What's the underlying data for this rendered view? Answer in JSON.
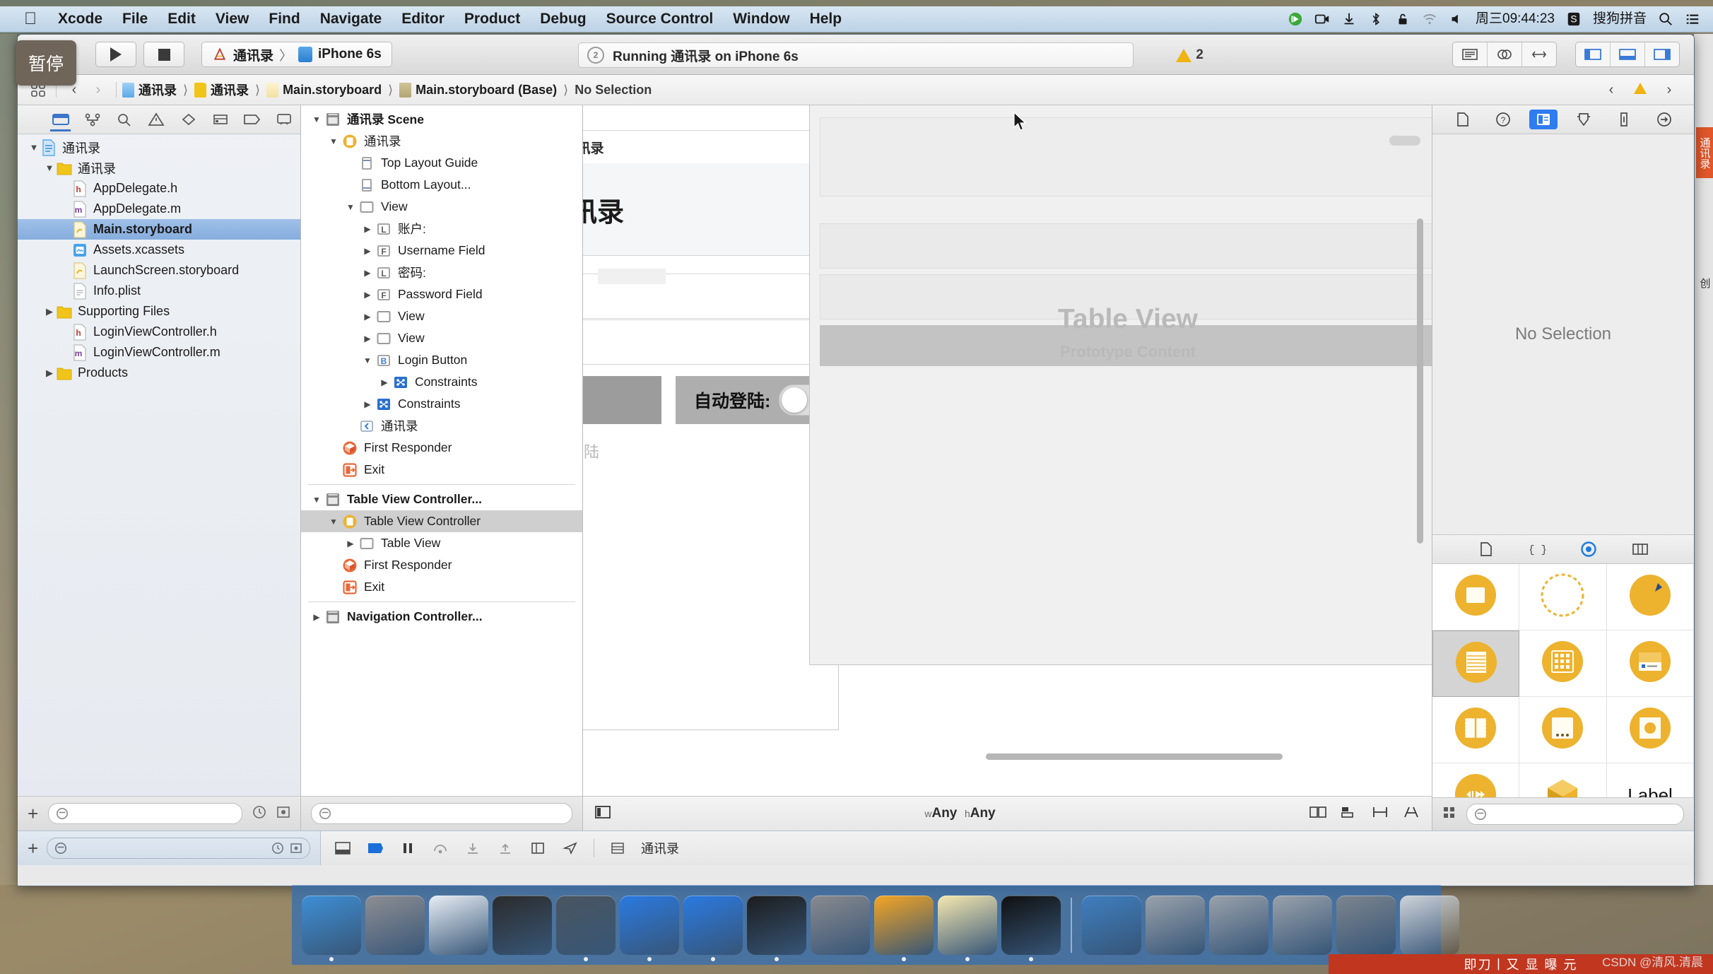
{
  "menubar": {
    "apple": "apple-logo",
    "items": [
      "Xcode",
      "File",
      "Edit",
      "View",
      "Find",
      "Navigate",
      "Editor",
      "Product",
      "Debug",
      "Source Control",
      "Window",
      "Help"
    ],
    "status_icons": [
      "sync-icon",
      "screen-record-icon",
      "airdrop-icon",
      "bluetooth-icon",
      "lock-icon",
      "wifi-icon",
      "volume-icon"
    ],
    "clock": "周三09:44:23",
    "input_method_badge": "S",
    "input_method": "搜狗拼音",
    "search_icon": "search-icon",
    "notification_icon": "notification-center-icon"
  },
  "tooltip": {
    "text": "暂停"
  },
  "toolbar": {
    "run_button": "run-icon",
    "stop_button": "stop-icon",
    "scheme_name": "通讯录",
    "scheme_separator": "〉",
    "destination": "iPhone 6s",
    "status": {
      "icon": "activity-icon",
      "text": "Running 通讯录 on iPhone 6s"
    },
    "warning_count": "2",
    "editor_segments": [
      "standard-editor-icon",
      "assistant-editor-icon",
      "version-editor-icon"
    ],
    "view_segments": [
      "navigator-toggle-icon",
      "debug-area-toggle-icon",
      "utilities-toggle-icon"
    ]
  },
  "jumpbar": {
    "related_icon": "related-items-icon",
    "back_icon": "chevron-left-icon",
    "forward_icon": "chevron-right-icon",
    "crumbs": [
      {
        "icon": "project-icon",
        "label": "通讯录"
      },
      {
        "icon": "folder-icon",
        "label": "通讯录"
      },
      {
        "icon": "storyboard-icon",
        "label": "Main.storyboard"
      },
      {
        "icon": "storyboard-base-icon",
        "label": "Main.storyboard (Base)"
      },
      {
        "icon": "",
        "label": "No Selection"
      }
    ],
    "right_icons": [
      "chevron-left-small-icon",
      "warning-icon",
      "chevron-right-small-icon"
    ]
  },
  "navigator": {
    "tabs": [
      "folder-navigator-icon",
      "source-control-icon",
      "search-navigator-icon",
      "issue-navigator-icon",
      "test-navigator-icon",
      "debug-navigator-icon",
      "breakpoint-navigator-icon",
      "report-navigator-icon"
    ],
    "selected_tab_index": 0,
    "items": [
      {
        "label": "通讯录",
        "indent": 0,
        "twisty": "down",
        "icon": "project-icon",
        "selected": false
      },
      {
        "label": "通讯录",
        "indent": 1,
        "twisty": "down",
        "icon": "folder-icon",
        "selected": false
      },
      {
        "label": "AppDelegate.h",
        "indent": 2,
        "twisty": "",
        "icon": "h-file-icon",
        "selected": false
      },
      {
        "label": "AppDelegate.m",
        "indent": 2,
        "twisty": "",
        "icon": "m-file-icon",
        "selected": false
      },
      {
        "label": "Main.storyboard",
        "indent": 2,
        "twisty": "",
        "icon": "storyboard-icon",
        "selected": true
      },
      {
        "label": "Assets.xcassets",
        "indent": 2,
        "twisty": "",
        "icon": "assets-icon",
        "selected": false
      },
      {
        "label": "LaunchScreen.storyboard",
        "indent": 2,
        "twisty": "",
        "icon": "storyboard-icon",
        "selected": false
      },
      {
        "label": "Info.plist",
        "indent": 2,
        "twisty": "",
        "icon": "plist-icon",
        "selected": false
      },
      {
        "label": "Supporting Files",
        "indent": 1,
        "twisty": "right",
        "icon": "folder-icon",
        "selected": false
      },
      {
        "label": "LoginViewController.h",
        "indent": 2,
        "twisty": "",
        "icon": "h-file-icon",
        "selected": false
      },
      {
        "label": "LoginViewController.m",
        "indent": 2,
        "twisty": "",
        "icon": "m-file-icon",
        "selected": false
      },
      {
        "label": "Products",
        "indent": 1,
        "twisty": "right",
        "icon": "folder-icon",
        "selected": false
      }
    ],
    "add_button": "plus-icon",
    "filter_placeholder": ""
  },
  "outline": {
    "items": [
      {
        "label": "通讯录 Scene",
        "indent": 0,
        "twisty": "down",
        "icon": "scene-icon",
        "bold": true,
        "selected": false
      },
      {
        "label": "通讯录",
        "indent": 1,
        "twisty": "down",
        "icon": "viewcontroller-icon",
        "bold": false,
        "selected": false
      },
      {
        "label": "Top Layout Guide",
        "indent": 2,
        "twisty": "",
        "icon": "top-guide-icon",
        "bold": false,
        "selected": false
      },
      {
        "label": "Bottom Layout...",
        "indent": 2,
        "twisty": "",
        "icon": "bottom-guide-icon",
        "bold": false,
        "selected": false
      },
      {
        "label": "View",
        "indent": 2,
        "twisty": "down",
        "icon": "view-icon",
        "bold": false,
        "selected": false
      },
      {
        "label": "账户:",
        "indent": 3,
        "twisty": "right",
        "icon": "label-icon",
        "bold": false,
        "selected": false
      },
      {
        "label": "Username Field",
        "indent": 3,
        "twisty": "right",
        "icon": "field-icon",
        "bold": false,
        "selected": false
      },
      {
        "label": "密码:",
        "indent": 3,
        "twisty": "right",
        "icon": "label-icon",
        "bold": false,
        "selected": false
      },
      {
        "label": "Password Field",
        "indent": 3,
        "twisty": "right",
        "icon": "field-icon",
        "bold": false,
        "selected": false
      },
      {
        "label": "View",
        "indent": 3,
        "twisty": "right",
        "icon": "view-icon",
        "bold": false,
        "selected": false
      },
      {
        "label": "View",
        "indent": 3,
        "twisty": "right",
        "icon": "view-icon",
        "bold": false,
        "selected": false
      },
      {
        "label": "Login Button",
        "indent": 3,
        "twisty": "down",
        "icon": "button-icon",
        "bold": false,
        "selected": false
      },
      {
        "label": "Constraints",
        "indent": 4,
        "twisty": "right",
        "icon": "constraints-icon",
        "bold": false,
        "selected": false
      },
      {
        "label": "Constraints",
        "indent": 3,
        "twisty": "right",
        "icon": "constraints-icon",
        "bold": false,
        "selected": false
      },
      {
        "label": "通讯录",
        "indent": 2,
        "twisty": "",
        "icon": "segue-icon",
        "bold": false,
        "selected": false
      },
      {
        "label": "First Responder",
        "indent": 1,
        "twisty": "",
        "icon": "first-responder-icon",
        "bold": false,
        "selected": false
      },
      {
        "label": "Exit",
        "indent": 1,
        "twisty": "",
        "icon": "exit-icon",
        "bold": false,
        "selected": false
      },
      {
        "separator": true
      },
      {
        "label": "Table View Controller...",
        "indent": 0,
        "twisty": "down",
        "icon": "scene-icon",
        "bold": true,
        "selected": false
      },
      {
        "label": "Table View Controller",
        "indent": 1,
        "twisty": "down",
        "icon": "viewcontroller-icon",
        "bold": false,
        "selected": true
      },
      {
        "label": "Table View",
        "indent": 2,
        "twisty": "right",
        "icon": "view-icon",
        "bold": false,
        "selected": false
      },
      {
        "label": "First Responder",
        "indent": 1,
        "twisty": "",
        "icon": "first-responder-icon",
        "bold": false,
        "selected": false
      },
      {
        "label": "Exit",
        "indent": 1,
        "twisty": "",
        "icon": "exit-icon",
        "bold": false,
        "selected": false
      },
      {
        "separator": true
      },
      {
        "label": "Navigation Controller...",
        "indent": 0,
        "twisty": "right",
        "icon": "scene-icon",
        "bold": true,
        "selected": false
      }
    ],
    "filter_icon": "filter-icon"
  },
  "canvas": {
    "login_scene": {
      "nav_title": "通讯录",
      "big_title": "通讯录",
      "switch_label": "自动登陆:",
      "login_button": "登陆"
    },
    "table_scene": {
      "title": "Table View",
      "subtitle": "Prototype Content"
    },
    "size_class": {
      "w_prefix": "w",
      "w_value": "Any",
      "h_prefix": "h",
      "h_value": "Any"
    },
    "bottom_left_icon": "document-outline-toggle-icon",
    "bottom_right_icons": [
      "constraints-icon",
      "align-icon",
      "pin-icon",
      "resolve-icon"
    ]
  },
  "inspector": {
    "tabs": [
      "file-inspector-icon",
      "quick-help-icon",
      "identity-inspector-icon",
      "attributes-inspector-icon",
      "size-inspector-icon",
      "connections-inspector-icon"
    ],
    "selected_tab_index": 2,
    "empty_text": "No Selection",
    "library_tabs": [
      "file-template-library-icon",
      "code-snippet-library-icon",
      "object-library-icon",
      "media-library-icon"
    ],
    "selected_library_index": 2,
    "library_items": [
      {
        "name": "partial-object-icon",
        "selected": false
      },
      {
        "name": "partial-dashed-object-icon",
        "selected": false
      },
      {
        "name": "partial-pin-object-icon",
        "selected": false
      },
      {
        "name": "table-view-object-icon",
        "selected": true
      },
      {
        "name": "collection-view-object-icon",
        "selected": false
      },
      {
        "name": "table-view-cell-object-icon",
        "selected": false
      },
      {
        "name": "split-view-object-icon",
        "selected": false
      },
      {
        "name": "scroll-view-object-icon",
        "selected": false
      },
      {
        "name": "image-view-object-icon",
        "selected": false
      },
      {
        "name": "media-controls-object-icon",
        "selected": false
      },
      {
        "name": "scene-kit-object-icon",
        "selected": false
      },
      {
        "name": "label-object-icon",
        "selected": false
      }
    ],
    "library_label": "Label",
    "library_bottom_icons": [
      "grid-view-icon",
      "filter-icon"
    ]
  },
  "debugbar": {
    "add_icon": "plus-icon",
    "filter_icon": "filter-icon",
    "clock_icon": "history-icon",
    "scope_icon": "scope-icon",
    "controls": [
      "hide-debug-icon",
      "continue-icon",
      "pause-icon",
      "step-over-icon",
      "step-into-icon",
      "step-out-icon",
      "view-hierarchy-icon",
      "location-icon"
    ],
    "thread_label": "通讯录"
  },
  "dock": {
    "apps": [
      {
        "name": "finder-icon",
        "color": "#3d8fd6",
        "running": true
      },
      {
        "name": "launchpad-icon",
        "color": "#8e8e93",
        "running": false
      },
      {
        "name": "safari-icon",
        "color": "#e8eef5",
        "running": false
      },
      {
        "name": "mouse-app-icon",
        "color": "#2b2b2b",
        "running": false
      },
      {
        "name": "quicktime-icon",
        "color": "#4a5560",
        "running": true
      },
      {
        "name": "xcode-icon",
        "color": "#2a7ae2",
        "running": true
      },
      {
        "name": "xcode-beta-icon",
        "color": "#2a7ae2",
        "running": true
      },
      {
        "name": "terminal-icon",
        "color": "#1c1c1c",
        "running": true
      },
      {
        "name": "system-preferences-icon",
        "color": "#8a8a8e",
        "running": false
      },
      {
        "name": "sketch-icon",
        "color": "#f5a623",
        "running": true
      },
      {
        "name": "notes-icon",
        "color": "#f6e9b0",
        "running": true
      },
      {
        "name": "iterm-icon",
        "color": "#101010",
        "running": true
      }
    ],
    "recent": [
      {
        "name": "media-player-icon",
        "color": "#3f7fbf"
      },
      {
        "name": "simulator-icon-1",
        "color": "#9aa2ab"
      },
      {
        "name": "simulator-icon-2",
        "color": "#9aa2ab"
      },
      {
        "name": "simulator-icon-3",
        "color": "#9aa2ab"
      },
      {
        "name": "simulator-icon-4",
        "color": "#7d858e"
      }
    ],
    "trash": {
      "name": "trash-icon",
      "color": "#cfd4da"
    }
  },
  "overlays": {
    "right_badge": "通讯录",
    "right_text": "创",
    "bottom_strip": "即刀丨又 显 曝 元",
    "watermark": "CSDN @清风.清晨"
  }
}
